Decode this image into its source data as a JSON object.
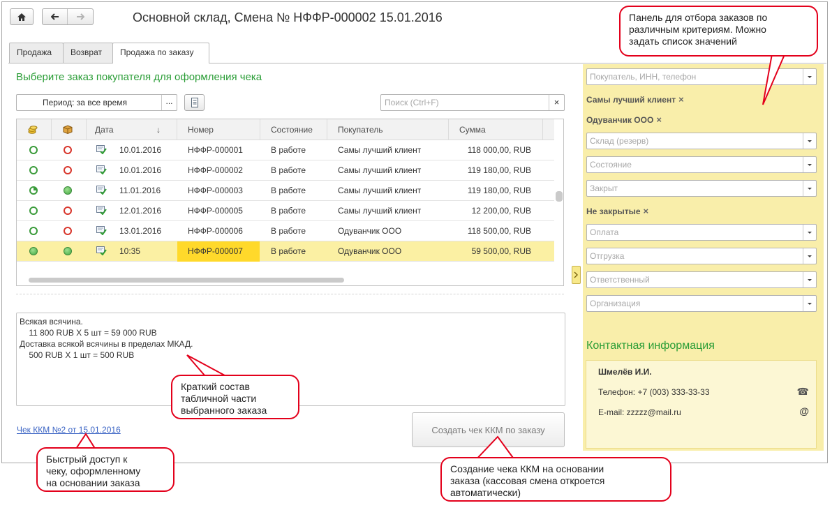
{
  "window": {
    "title": "Основной склад, Смена № НФФР-000002  15.01.2016"
  },
  "tabs": [
    {
      "label": "Продажа"
    },
    {
      "label": "Возврат"
    },
    {
      "label": "Продажа по заказу"
    }
  ],
  "main": {
    "heading": "Выберите заказ покупателя для оформления чека",
    "period_label": "Период: за все время",
    "period_ellipsis": "...",
    "search_placeholder": "Поиск (Ctrl+F)"
  },
  "table": {
    "columns": [
      "",
      "",
      "Дата",
      "Номер",
      "Состояние",
      "Покупатель",
      "Сумма"
    ],
    "sort_indicator": "↓",
    "rows": [
      {
        "paid": "open",
        "shipped": "red",
        "date": "10.01.2016",
        "number": "НФФР-000001",
        "state": "В работе",
        "customer": "Самы лучший клиент",
        "sum": "118 000,00, RUB"
      },
      {
        "paid": "open",
        "shipped": "red",
        "date": "10.01.2016",
        "number": "НФФР-000002",
        "state": "В работе",
        "customer": "Самы лучший клиент",
        "sum": "119 180,00, RUB"
      },
      {
        "paid": "partial",
        "shipped": "filled",
        "date": "11.01.2016",
        "number": "НФФР-000003",
        "state": "В работе",
        "customer": "Самы лучший клиент",
        "sum": "119 180,00, RUB"
      },
      {
        "paid": "open",
        "shipped": "red",
        "date": "12.01.2016",
        "number": "НФФР-000005",
        "state": "В работе",
        "customer": "Самы лучший клиент",
        "sum": "12 200,00, RUB"
      },
      {
        "paid": "open",
        "shipped": "red",
        "date": "13.01.2016",
        "number": "НФФР-000006",
        "state": "В работе",
        "customer": "Одуванчик ООО",
        "sum": "118 500,00, RUB"
      },
      {
        "paid": "filled",
        "shipped": "filled",
        "date": "10:35",
        "number": "НФФР-000007",
        "state": "В работе",
        "customer": "Одуванчик ООО",
        "sum": "59 500,00, RUB",
        "selected": true
      }
    ]
  },
  "details": {
    "lines": [
      "Всякая всячина.",
      "    11 800 RUB X 5 шт = 59 000 RUB",
      "Доставка всякой всячины в пределах МКАД.",
      "    500 RUB X 1 шт = 500 RUB"
    ]
  },
  "footer": {
    "receipt_link": "Чек ККМ №2 от 15.01.2016",
    "create_button": "Создать чек ККМ по заказу"
  },
  "filters": {
    "customer_placeholder": "Покупатель, ИНН, телефон",
    "customer_tags": [
      "Самы лучший клиент",
      "Одуванчик ООО"
    ],
    "tag_remove": "×",
    "warehouse_placeholder": "Склад (резерв)",
    "state_placeholder": "Состояние",
    "closed_placeholder": "Закрыт",
    "closed_tag": "Не закрытые",
    "payment_placeholder": "Оплата",
    "shipment_placeholder": "Отгрузка",
    "responsible_placeholder": "Ответственный",
    "organization_placeholder": "Организация"
  },
  "contact": {
    "heading": "Контактная информация",
    "name": "Шмелёв И.И.",
    "phone": "Телефон: +7 (003) 333-33-33",
    "email": "E-mail: zzzzz@mail.ru",
    "phone_icon": "☎",
    "email_icon": "@"
  },
  "callouts": {
    "panel": [
      "Панель для отбора заказов по",
      "различным критериям. Можно",
      "задать список значений"
    ],
    "contents": [
      "Краткий состав",
      "табличной части",
      "выбранного заказа"
    ],
    "quick_access": [
      "Быстрый доступ к",
      "чеку, оформленному",
      "на основании заказа"
    ],
    "create": [
      "Создание чека ККМ на основании",
      "заказа (кассовая смена откроется",
      "автоматически)"
    ]
  },
  "colors": {
    "accent_green": "#2a9d36",
    "panel_yellow": "#f9eeaa",
    "selected_row": "#fbf0a3",
    "selected_number": "#ffd92b",
    "callout_border": "#e3001b",
    "link_blue": "#3b64c4"
  }
}
